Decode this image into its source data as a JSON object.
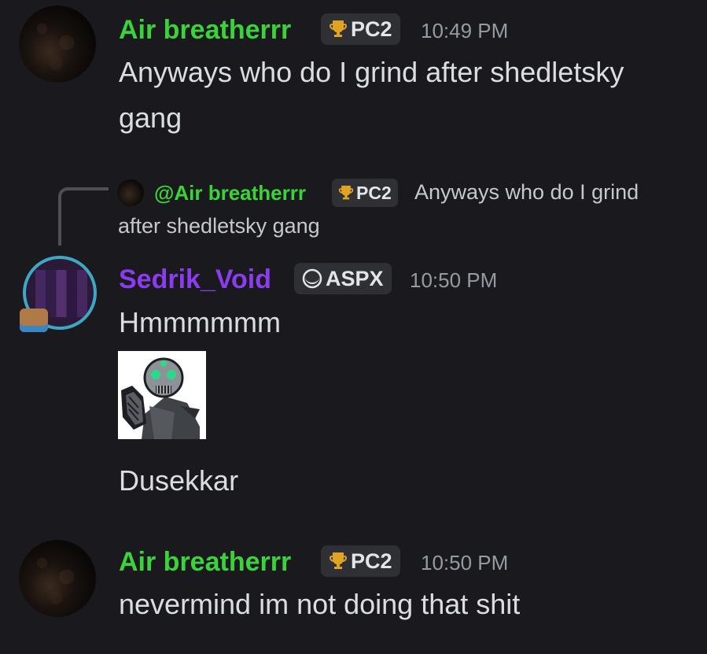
{
  "colors": {
    "background": "#1a1a1e",
    "air_breatherrr_name": "#3ad43a",
    "sedrik_void_name": "#8c3cf0",
    "timestamp": "#949ba4",
    "message_text": "#dbdee1",
    "badge_bg": "#2e3035"
  },
  "messages": [
    {
      "author": "Air breatherrr",
      "badge": {
        "icon": "trophy-icon",
        "label": "PC2"
      },
      "time": "10:49 PM",
      "lines": [
        "Anyways who do I grind after shedletsky",
        "gang"
      ]
    },
    {
      "reply": {
        "mention": "@Air breatherrr",
        "badge": {
          "icon": "trophy-icon",
          "label": "PC2"
        },
        "text_line1": "Anyways who do I grind",
        "text_line2": "after shedletsky gang"
      },
      "author": "Sedrik_Void",
      "badge": {
        "icon": "moon-icon",
        "label": "ASPX"
      },
      "time": "10:50 PM",
      "lines": [
        "Hmmmmmm"
      ],
      "attachment": {
        "icon": "sticker-character-icon"
      },
      "after_attachment": "Dusekkar"
    },
    {
      "author": "Air breatherrr",
      "badge": {
        "icon": "trophy-icon",
        "label": "PC2"
      },
      "time": "10:50 PM",
      "lines": [
        "nevermind im not doing that shit"
      ]
    }
  ]
}
